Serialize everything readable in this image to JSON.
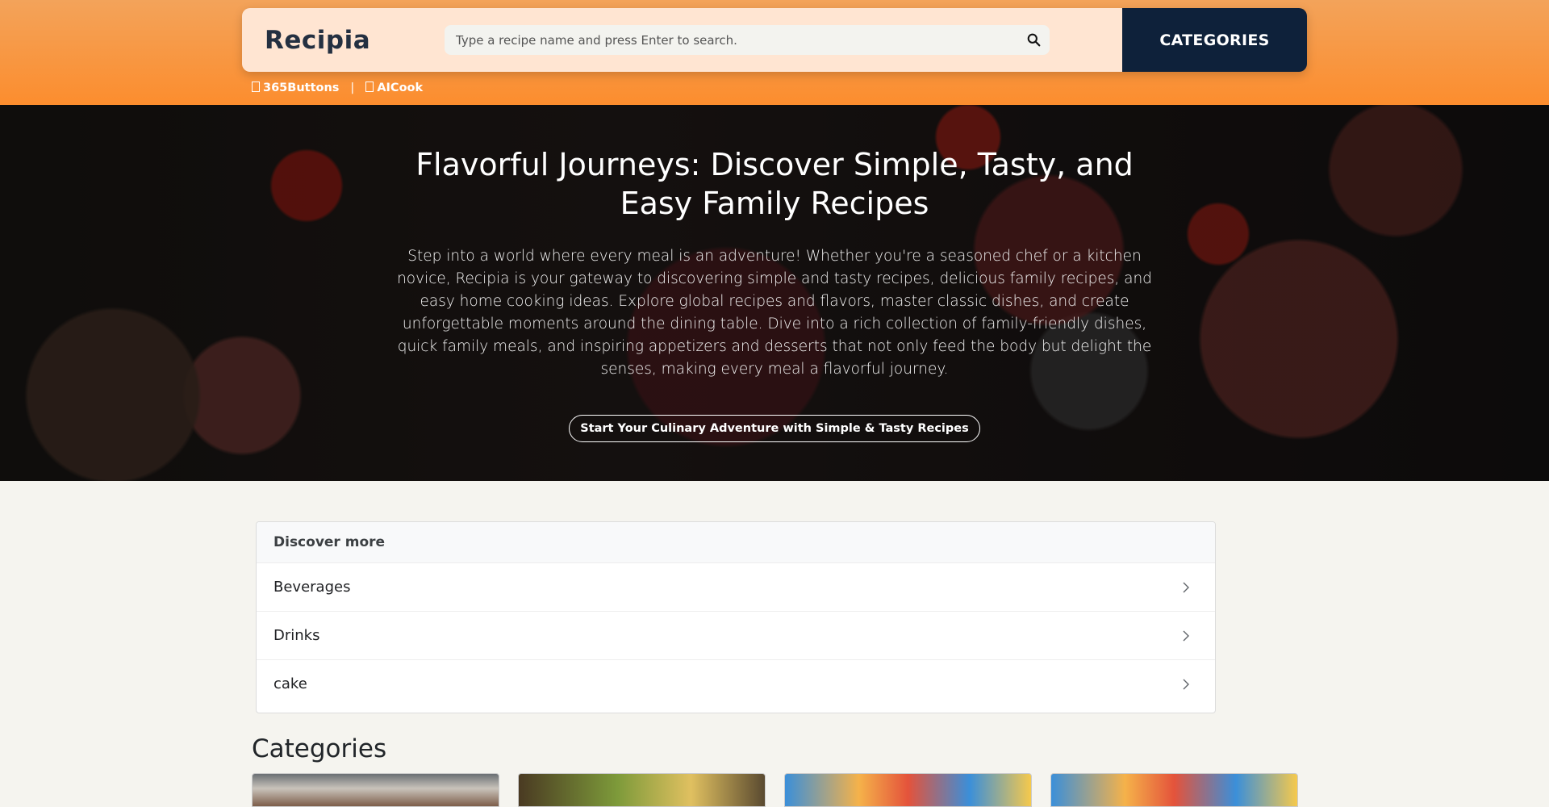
{
  "header": {
    "logo": "Recipia",
    "search": {
      "placeholder": "Type a recipe name and press Enter to search.",
      "value": "",
      "icon": "search-icon"
    },
    "categories_label": "CATEGORIES",
    "links": [
      {
        "label": "365Buttons"
      },
      {
        "label": "AICook"
      }
    ],
    "link_separator": "|"
  },
  "hero": {
    "title": "Flavorful Journeys: Discover Simple, Tasty, and Easy Family Recipes",
    "text": "Step into a world where every meal is an adventure! Whether you're a seasoned chef or a kitchen novice, Recipia is your gateway to discovering simple and tasty recipes, delicious family recipes, and easy home cooking ideas. Explore global recipes and flavors, master classic dishes, and create unforgettable moments around the dining table. Dive into a rich collection of family-friendly dishes, quick family meals, and inspiring appetizers and desserts that not only feed the body but delight the senses, making every meal a flavorful journey.",
    "cta": "Start Your Culinary Adventure with Simple & Tasty Recipes"
  },
  "discover": {
    "heading": "Discover more",
    "items": [
      {
        "label": "Beverages"
      },
      {
        "label": "Drinks"
      },
      {
        "label": "cake"
      }
    ]
  },
  "categories": {
    "title": "Categories"
  },
  "colors": {
    "header_orange": "#fc8d2e",
    "navy": "#0e213a",
    "logo_text": "#243041",
    "background": "#f5f4ef"
  }
}
